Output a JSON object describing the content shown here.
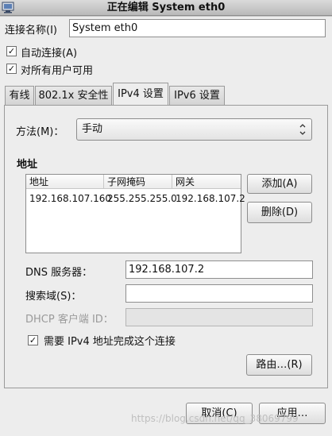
{
  "window": {
    "title": "正在编辑 System eth0"
  },
  "connection": {
    "name_label": "连接名称(I)",
    "name_value": "System eth0",
    "auto_connect_label": "自动连接(A)",
    "auto_connect_checked": true,
    "all_users_label": "对所有用户可用",
    "all_users_checked": true
  },
  "tabs": [
    {
      "label": "有线",
      "active": false
    },
    {
      "label": "802.1x 安全性",
      "active": false
    },
    {
      "label": "IPv4 设置",
      "active": true
    },
    {
      "label": "IPv6 设置",
      "active": false
    }
  ],
  "ipv4": {
    "method_label": "方法(M)：",
    "method_value": "手动",
    "addresses_heading": "地址",
    "table": {
      "headers": [
        "地址",
        "子网掩码",
        "网关"
      ],
      "rows": [
        [
          "192.168.107.160",
          "255.255.255.0",
          "192.168.107.2"
        ]
      ]
    },
    "add_button": "添加(A)",
    "delete_button": "删除(D)",
    "dns_label": "DNS 服务器：",
    "dns_value": "192.168.107.2",
    "search_label": "搜索域(S)：",
    "search_value": "",
    "dhcp_label": "DHCP 客户端 ID：",
    "dhcp_value": "",
    "require_label": "需要 IPv4 地址完成这个连接",
    "require_checked": true,
    "routes_button": "路由…(R)"
  },
  "footer": {
    "cancel_button": "取消(C)",
    "apply_button": "应用…",
    "watermark": "https://blog.csdn.net/qq_38069799"
  },
  "icons": {
    "app": "network-settings-icon",
    "check": "checkmark-icon",
    "select": "updown-chevron-icon"
  }
}
